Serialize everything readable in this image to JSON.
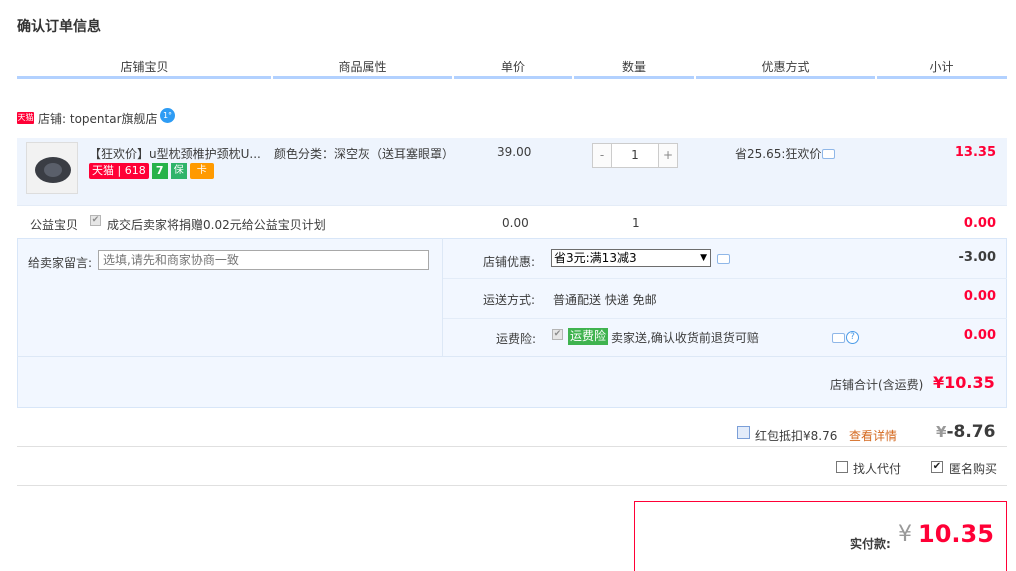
{
  "page": {
    "title": "确认订单信息"
  },
  "columns": [
    "店铺宝贝",
    "商品属性",
    "单价",
    "数量",
    "优惠方式",
    "小计"
  ],
  "shop": {
    "badge": "天猫",
    "name": "店铺: topentar旗舰店"
  },
  "item": {
    "title": "【狂欢价】u型枕颈椎护颈枕U...",
    "badges": {
      "tmall": "天猫 | 618",
      "seven": "7",
      "shield": "保",
      "card": "卡"
    },
    "attribute": "颜色分类：深空灰（送耳塞眼罩）",
    "price": "39.00",
    "quantity": {
      "minus": "-",
      "value": "1",
      "plus": "+"
    },
    "promotion": "省25.65:狂欢价",
    "subtotal": "13.35"
  },
  "charity": {
    "label": "公益宝贝",
    "check": "✔",
    "text": "成交后卖家将捐赠0.02元给公益宝贝计划",
    "price": "0.00",
    "quantity": "1",
    "subtotal": "0.00"
  },
  "order_options": {
    "message_label": "给卖家留言:",
    "message_placeholder": "选填,请先和商家协商一致",
    "shop_discount_label": "店铺优惠:",
    "shop_discount_value": "省3元:满13减3",
    "shop_discount_amount": "-3.00",
    "shipping_label": "运送方式:",
    "shipping_value": "普通配送 快递 免邮",
    "shipping_amount": "0.00",
    "insurance_label": "运费险:",
    "insurance_check": "✔",
    "insurance_tag": "运费险",
    "insurance_text": "卖家送,确认收货前退货可赔",
    "insurance_amount": "0.00",
    "help_icon": "?"
  },
  "shop_total": {
    "label": "店铺合计(含运费)",
    "amount": "¥10.35"
  },
  "red_packet": {
    "label": "红包抵扣¥8.76",
    "link": "查看详情",
    "yen": "¥",
    "amount": "-8.76"
  },
  "options": {
    "proxy_pay": "找人代付",
    "anonymous": "匿名购买",
    "check": "✔"
  },
  "payment": {
    "label": "实付款:",
    "yen": "¥",
    "amount": "10.35"
  },
  "colors": {
    "accent_red": "#ff0036",
    "header_line": "#b2d1ff",
    "panel_bg": "#eef4fd"
  }
}
